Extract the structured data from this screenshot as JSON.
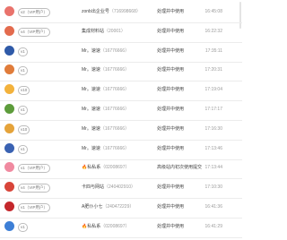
{
  "rows": [
    {
      "badge": "v2（VIP用户）",
      "name": "zonb出企业号",
      "id": "（716998668）",
      "status": "处理并中使用",
      "time": "16:45:08",
      "icon": "#e9736c",
      "icon_name": "camera-avatar-icon"
    },
    {
      "badge": "v4（VIP用户）",
      "name": "集成材料站",
      "id": "（20001）",
      "status": "处理并中使用",
      "time": "16:22:32",
      "icon": "#e36b4e",
      "icon_name": "store-avatar-icon"
    },
    {
      "badge": "v1",
      "name": "Mr。速速",
      "id": "（16776666）",
      "status": "处理并中使用",
      "time": "17:35:11",
      "icon": "#2f5aa8",
      "icon_name": "avatar-icon"
    },
    {
      "badge": "v1",
      "name": "Mr。速速",
      "id": "（16776666）",
      "status": "处理并中使用",
      "time": "17:20:31",
      "icon": "#e07c3a",
      "icon_name": "avatar-icon"
    },
    {
      "badge": "v10",
      "name": "Mr。速速",
      "id": "（16776666）",
      "status": "处理并中使用",
      "time": "17:19:04",
      "icon": "#f3b23c",
      "icon_name": "crown-avatar-icon"
    },
    {
      "badge": "v1",
      "name": "Mr。速速",
      "id": "（16776666）",
      "status": "处理并中使用",
      "time": "17:17:17",
      "icon": "#5d9c3b",
      "icon_name": "avatar-icon"
    },
    {
      "badge": "v10",
      "name": "Mr。速速",
      "id": "（16776666）",
      "status": "处理并中使用",
      "time": "17:16:30",
      "icon": "#e5a33a",
      "icon_name": "avatar-icon"
    },
    {
      "badge": "v1",
      "name": "Mr。速速",
      "id": "（16776666）",
      "status": "处理并中使用",
      "time": "17:13:46",
      "icon": "#3a62b2",
      "icon_name": "avatar-icon"
    },
    {
      "badge": "v1（VIP用户）",
      "name": "🔥私私系",
      "id": "（02008697）",
      "status": "高级站内初次使用提交",
      "time": "17:13:44",
      "icon": "#f08aa0",
      "icon_name": "avatar-icon"
    },
    {
      "badge": "v4（VIP用户）",
      "name": "卡四与网站",
      "id": "（240402910）",
      "status": "处理并中使用",
      "time": "17:10:30",
      "icon": "#d8453a",
      "icon_name": "avatar-icon"
    },
    {
      "badge": "v1（VIP用户）",
      "name": "A肥仆小七",
      "id": "（240472229）",
      "status": "处理并中使用",
      "time": "16:41:36",
      "icon": "#c4282c",
      "icon_name": "lips-avatar-icon"
    },
    {
      "badge": "v1",
      "name": "🔥私私系",
      "id": "（02008697）",
      "status": "处理并中使用",
      "time": "16:41:29",
      "icon": "#3d7fd6",
      "icon_name": "avatar-icon"
    }
  ]
}
